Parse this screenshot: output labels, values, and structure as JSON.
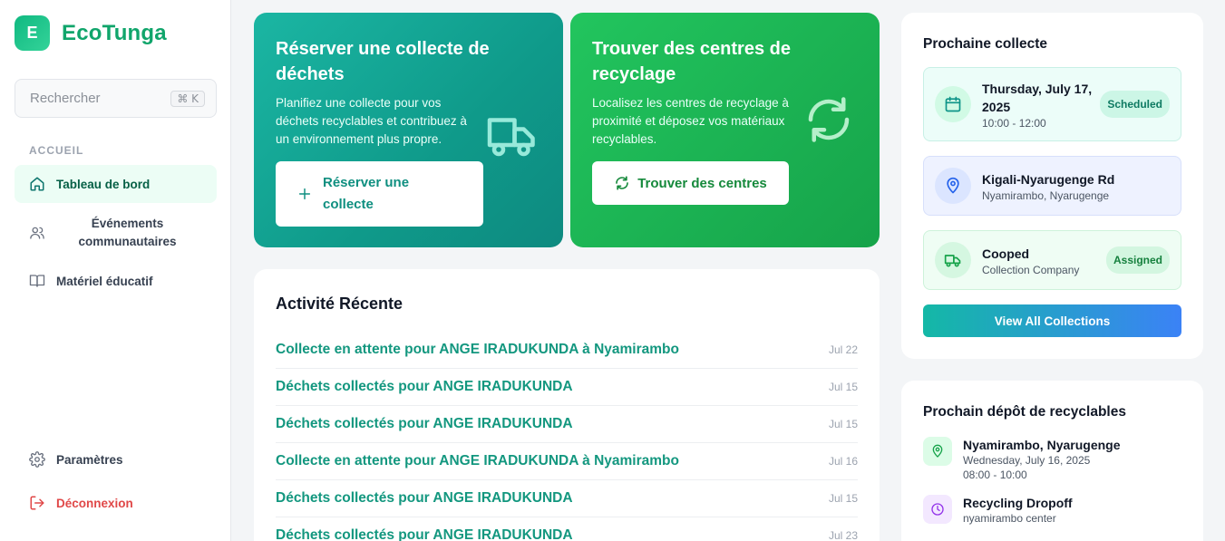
{
  "brand": {
    "logo_letter": "E",
    "name": "EcoTunga"
  },
  "search": {
    "placeholder": "Rechercher",
    "shortcut": "⌘ K"
  },
  "sidebar": {
    "section_label": "ACCUEIL",
    "items": [
      {
        "label": "Tableau de bord",
        "icon": "home-icon",
        "active": true
      },
      {
        "label": "Événements communautaires",
        "icon": "users-icon"
      },
      {
        "label": "Matériel éducatif",
        "icon": "book-icon"
      }
    ],
    "settings_label": "Paramètres",
    "logout_label": "Déconnexion"
  },
  "hero_collect": {
    "title": "Réserver une collecte de déchets",
    "description": "Planifiez une collecte pour vos déchets recyclables et contribuez à un environnement plus propre.",
    "button_label": "Réserver une collecte",
    "icon": "truck-icon"
  },
  "hero_recycle": {
    "title": "Trouver des centres de recyclage",
    "description": "Localisez les centres de recyclage à proximité et déposez vos matériaux recyclables.",
    "button_label": "Trouver des centres",
    "icon": "recycle-icon"
  },
  "activity": {
    "title": "Activité Récente",
    "items": [
      {
        "text": "Collecte en attente pour ANGE IRADUKUNDA à Nyamirambo",
        "date": "Jul 22"
      },
      {
        "text": "Déchets collectés pour ANGE IRADUKUNDA",
        "date": "Jul 15"
      },
      {
        "text": "Déchets collectés pour ANGE IRADUKUNDA",
        "date": "Jul 15"
      },
      {
        "text": "Collecte en attente pour ANGE IRADUKUNDA à Nyamirambo",
        "date": "Jul 16"
      },
      {
        "text": "Déchets collectés pour ANGE IRADUKUNDA",
        "date": "Jul 15"
      },
      {
        "text": "Déchets collectés pour ANGE IRADUKUNDA",
        "date": "Jul 23"
      }
    ]
  },
  "next_collection": {
    "title": "Prochaine collecte",
    "date": "Thursday, July 17, 2025",
    "time": "10:00 - 12:00",
    "status": "Scheduled",
    "location_main": "Kigali-Nyarugenge Rd",
    "location_sub": "Nyamirambo, Nyarugenge",
    "company_name": "Cooped",
    "company_sub": "Collection Company",
    "company_status": "Assigned",
    "view_all_label": "View All Collections"
  },
  "next_dropoff": {
    "title": "Prochain dépôt de recyclables",
    "location": "Nyamirambo, Nyarugenge",
    "date": "Wednesday, July 16, 2025",
    "time": "08:00 - 10:00",
    "type": "Recycling Dropoff",
    "center": "nyamirambo center"
  },
  "colors": {
    "accent_green": "#10a56b",
    "teal": "#0f9a8a",
    "green": "#16a34a",
    "logout_red": "#e04848"
  }
}
